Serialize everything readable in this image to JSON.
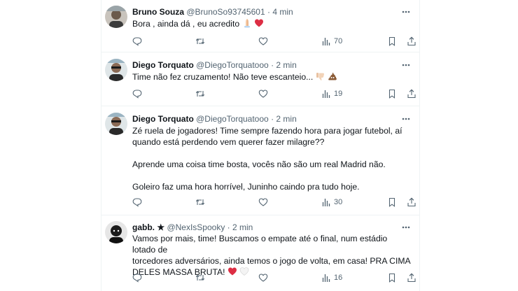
{
  "tweets": [
    {
      "name": "Bruno Souza",
      "handle": "@BrunoSo93745601",
      "dot": "·",
      "time": "4 min",
      "lines": [
        "Bora , ainda dá , eu acredito"
      ],
      "emoji": [
        "folded-hands",
        "red-heart"
      ],
      "views": "70",
      "replies": "",
      "retweets": "",
      "likes": ""
    },
    {
      "name": "Diego Torquato",
      "handle": "@DiegoTorquatooo",
      "dot": "·",
      "time": "2 min",
      "lines": [
        "Time não fez cruzamento! Não teve escanteio..."
      ],
      "emoji": [
        "thumbs-down",
        "pile-of-poo"
      ],
      "views": "19",
      "replies": "",
      "retweets": "",
      "likes": ""
    },
    {
      "name": "Diego Torquato",
      "handle": "@DiegoTorquatooo",
      "dot": "·",
      "time": "2 min",
      "lines": [
        "Zé ruela de jogadores! Time sempre fazendo hora para jogar futebol, aí",
        "quando está perdendo vem querer fazer milagre??",
        "",
        "Aprende uma coisa time bosta, vocês não são um real Madrid não.",
        "",
        "Goleiro faz uma hora horrível, Juninho caindo pra tudo hoje."
      ],
      "emoji": [],
      "views": "30",
      "replies": "",
      "retweets": "",
      "likes": ""
    },
    {
      "name": "gabb. ★",
      "handle": "@NexIsSpooky",
      "dot": "·",
      "time": "2 min",
      "lines": [
        "Vamos por mais, time! Buscamos o empate até o final, num estádio lotado de",
        "torcedores adversários, ainda temos o jogo de volta, em casa! PRA CIMA",
        "DELES MASSA BRUTA!"
      ],
      "emoji": [
        "red-heart",
        "white-heart"
      ],
      "views": "16",
      "replies": "",
      "retweets": "",
      "likes": ""
    }
  ],
  "colors": {
    "text": "#0f1419",
    "muted": "#536471",
    "border": "#eff3f4",
    "heart": "#f91880"
  }
}
